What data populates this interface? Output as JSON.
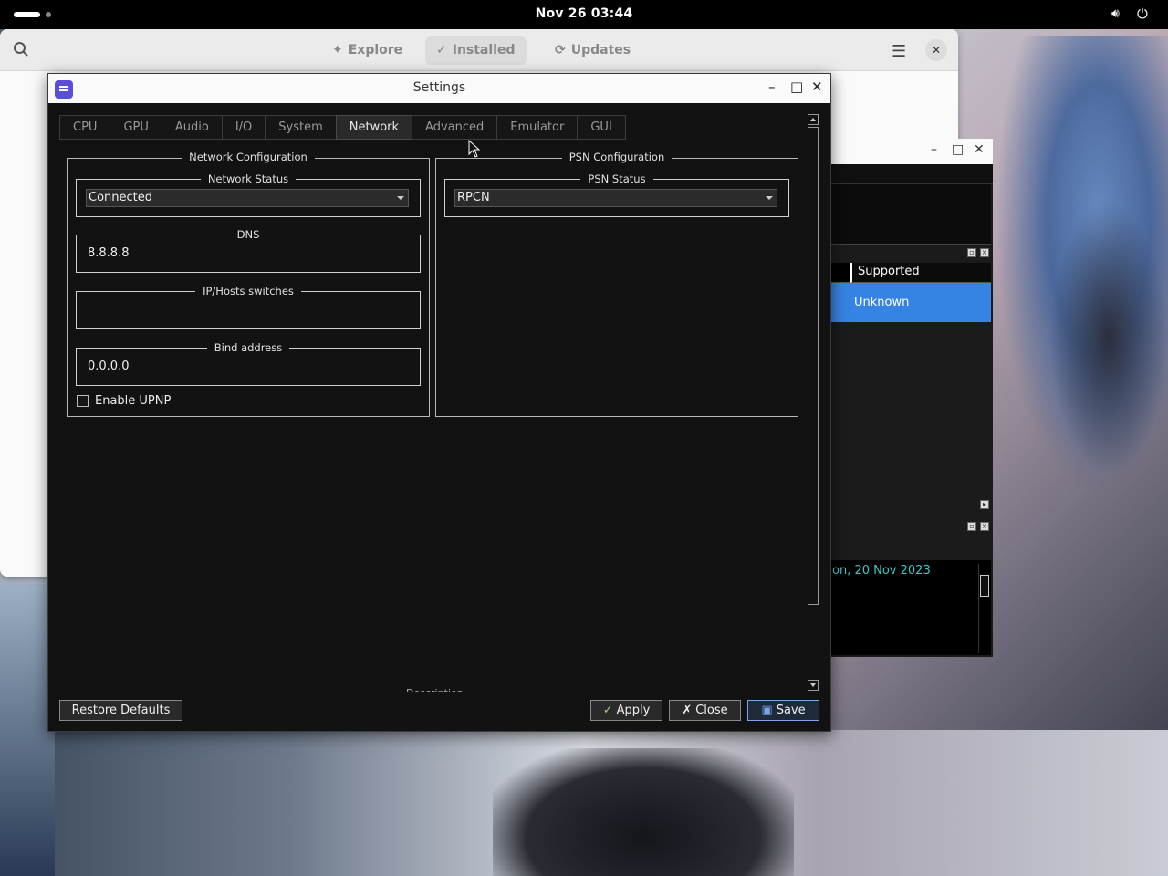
{
  "topbar": {
    "clock": "Nov 26  03:44",
    "volume_icon": "volume-icon",
    "power_icon": "power-icon"
  },
  "software_window": {
    "tabs": [
      {
        "label": "Explore",
        "icon": "sparkle-icon"
      },
      {
        "label": "Installed",
        "icon": "check-circle-icon",
        "active": true
      },
      {
        "label": "Updates",
        "icon": "refresh-icon"
      }
    ]
  },
  "secondary_window": {
    "column_header": "Supported Resolutions",
    "selected_value": "Unknown",
    "log_text": "on, 20 Nov 2023"
  },
  "settings_dialog": {
    "title": "Settings",
    "tabs": [
      {
        "label": "CPU"
      },
      {
        "label": "GPU"
      },
      {
        "label": "Audio"
      },
      {
        "label": "I/O"
      },
      {
        "label": "System"
      },
      {
        "label": "Network",
        "active": true
      },
      {
        "label": "Advanced"
      },
      {
        "label": "Emulator"
      },
      {
        "label": "GUI"
      }
    ],
    "network_configuration": {
      "title": "Network Configuration",
      "network_status": {
        "title": "Network Status",
        "value": "Connected"
      },
      "dns": {
        "title": "DNS",
        "value": "8.8.8.8"
      },
      "ip_hosts": {
        "title": "IP/Hosts switches",
        "value": ""
      },
      "bind_address": {
        "title": "Bind address",
        "value": "0.0.0.0"
      },
      "enable_upnp": {
        "label": "Enable UPNP",
        "checked": false
      }
    },
    "psn_configuration": {
      "title": "PSN Configuration",
      "psn_status": {
        "title": "PSN Status",
        "value": "RPCN"
      }
    },
    "buttons": {
      "restore_defaults": "Restore Defaults",
      "apply": "Apply",
      "close": "Close",
      "save": "Save"
    }
  }
}
